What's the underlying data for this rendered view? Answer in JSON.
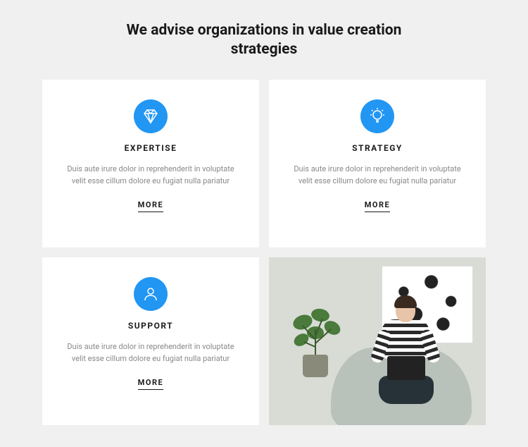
{
  "heading": "We advise organizations in value creation strategies",
  "cards": [
    {
      "icon": "diamond-icon",
      "title": "EXPERTISE",
      "desc": "Duis aute irure dolor in reprehenderit in voluptate velit esse cillum dolore eu fugiat nulla pariatur",
      "link": "MORE"
    },
    {
      "icon": "lightbulb-icon",
      "title": "STRATEGY",
      "desc": "Duis aute irure dolor in reprehenderit in voluptate velit esse cillum dolore eu fugiat nulla pariatur",
      "link": "MORE"
    },
    {
      "icon": "person-icon",
      "title": "SUPPORT",
      "desc": "Duis aute irure dolor in reprehenderit in voluptate velit esse cillum dolore eu fugiat nulla pariatur",
      "link": "MORE"
    }
  ],
  "colors": {
    "accent": "#2196f3"
  }
}
